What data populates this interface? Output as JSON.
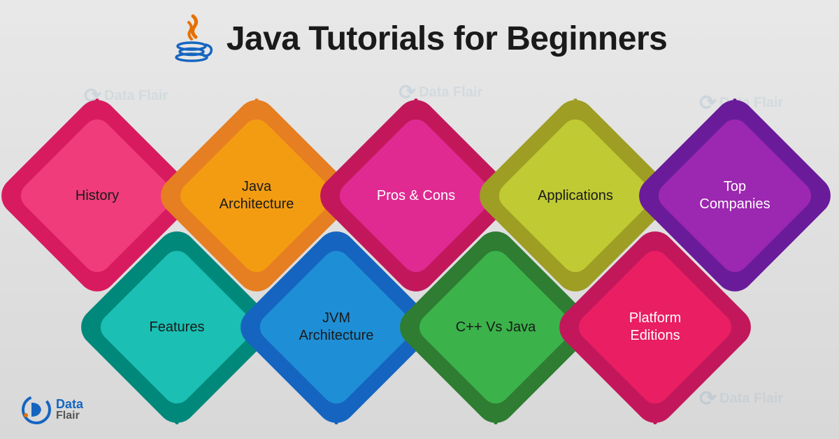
{
  "title": "Java Tutorials for Beginners",
  "brand": {
    "line1": "Data",
    "line2": "Flair"
  },
  "watermark": "Data Flair",
  "topics": {
    "row1": [
      {
        "label": "History",
        "color": "c1"
      },
      {
        "label": "Java Architecture",
        "color": "c2"
      },
      {
        "label": "Pros & Cons",
        "color": "c3"
      },
      {
        "label": "Applications",
        "color": "c4"
      },
      {
        "label": "Top Companies",
        "color": "c5"
      }
    ],
    "row2": [
      {
        "label": "Features",
        "color": "c6"
      },
      {
        "label": "JVM Architecture",
        "color": "c7"
      },
      {
        "label": "C++ Vs Java",
        "color": "c8"
      },
      {
        "label": "Platform Editions",
        "color": "c9"
      }
    ]
  }
}
